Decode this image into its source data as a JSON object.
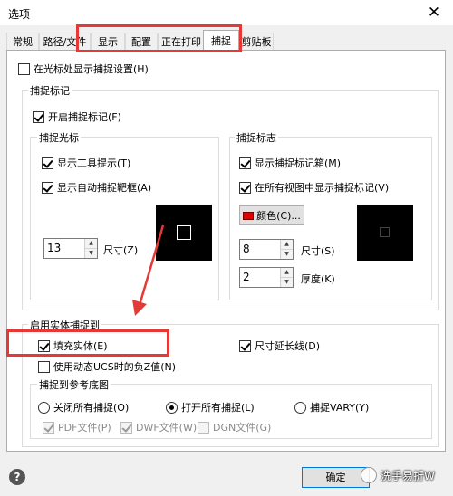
{
  "window": {
    "title": "选项",
    "close_glyph": "✕"
  },
  "tabs": [
    "常规",
    "路径/文件",
    "显示",
    "配置",
    "正在打印",
    "捕捉",
    "剪贴板"
  ],
  "options": {
    "show_at_cursor": "在光标处显示捕捉设置(H)"
  },
  "snap_marker": {
    "group_label": "捕捉标记",
    "enable": "开启捕捉标记(F)",
    "cursor": {
      "group_label": "捕捉光标",
      "tooltip": "显示工具提示(T)",
      "auto_frame": "显示自动捕捉靶框(A)",
      "size_value": "13",
      "size_label": "尺寸(Z)"
    },
    "sign": {
      "group_label": "捕捉标志",
      "box": "显示捕捉标记箱(M)",
      "all_views": "在所有视图中显示捕捉标记(V)",
      "color_button": "颜色(C)...",
      "size_value": "8",
      "size_label": "尺寸(S)",
      "thickness_value": "2",
      "thickness_label": "厚度(K)"
    }
  },
  "solid_snap": {
    "group_label": "启用实体捕捉到",
    "fill_solid": "填充实体(E)",
    "extend_line": "尺寸延长线(D)",
    "dynamic_ucs": "使用动态UCS时的负Z值(N)",
    "underlay": {
      "group_label": "捕捉到参考底图",
      "off_all": "关闭所有捕捉(O)",
      "on_all": "打开所有捕捉(L)",
      "vary": "捕捉VARY(Y)",
      "pdf": "PDF文件(P)",
      "dwf": "DWF文件(W)",
      "dgn": "DGN文件(G)"
    }
  },
  "footer": {
    "help_glyph": "?",
    "ok": "确定",
    "watermark": "洗手易折W"
  },
  "colors": {
    "highlight": "#e53935",
    "marker_red": "#e00000"
  }
}
